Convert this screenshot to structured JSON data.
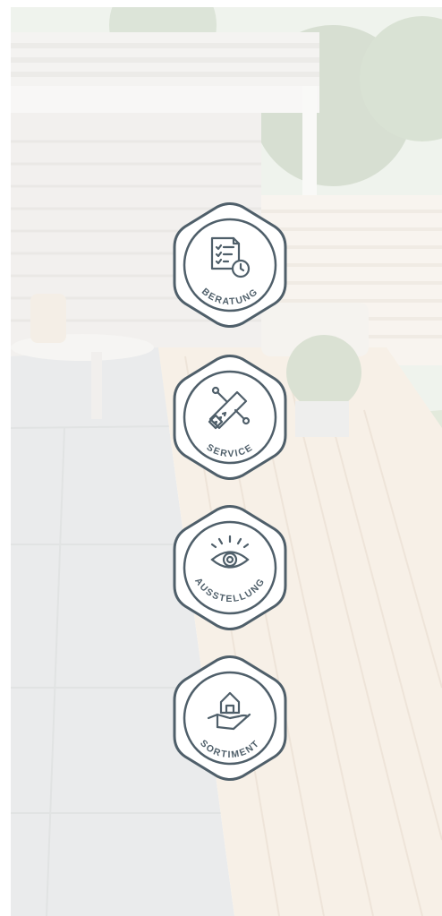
{
  "colors": {
    "badge_stroke": "#4f5f6a",
    "badge_fill": "#ffffff"
  },
  "background": {
    "scene": "wooden-deck-terrace-photo",
    "overlay": "white-wash"
  },
  "badges": [
    {
      "label": "BERATUNG",
      "icon": "consultation-clipboard-icon"
    },
    {
      "label": "SERVICE",
      "icon": "saw-and-tools-icon"
    },
    {
      "label": "AUSSTELLUNG",
      "icon": "eye-icon"
    },
    {
      "label": "SORTIMENT",
      "icon": "house-in-hand-icon"
    }
  ]
}
